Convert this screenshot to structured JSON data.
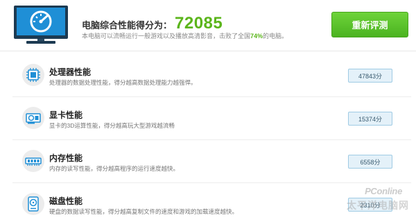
{
  "header": {
    "score_label": "电脑综合性能得分为：",
    "score_value": "72085",
    "desc_before": "本电脑可以流畅运行一般游戏以及播放高清影音，击败了全国",
    "desc_percent": "74%",
    "desc_after": "的电脑。",
    "retest_label": "重新评测",
    "monitor_icon": "speedometer-monitor-icon"
  },
  "rows": [
    {
      "title": "处理器性能",
      "desc": "处理器的数据处理性能，得分越高数据处理能力越强悍。",
      "score": "47843分",
      "icon": "cpu-icon"
    },
    {
      "title": "显卡性能",
      "desc": "显卡的3D运算性能，得分越高玩大型游戏越流畅",
      "score": "15374分",
      "icon": "graphics-card-icon"
    },
    {
      "title": "内存性能",
      "desc": "内存的读写性能，得分越高程序的运行速度越快。",
      "score": "6558分",
      "icon": "memory-icon"
    },
    {
      "title": "磁盘性能",
      "desc": "硬盘的数据读写性能，得分越高复制文件的速度和游戏的加载速度越快。",
      "score": "2310分",
      "icon": "disk-icon"
    }
  ],
  "watermark": {
    "logo": "PConline",
    "sub": "太平洋电脑网"
  },
  "colors": {
    "accent_green": "#5bb51b",
    "score_box_bg": "#e4f1f9",
    "score_box_border": "#9fcbe4",
    "monitor_blue": "#1f8fd6"
  }
}
